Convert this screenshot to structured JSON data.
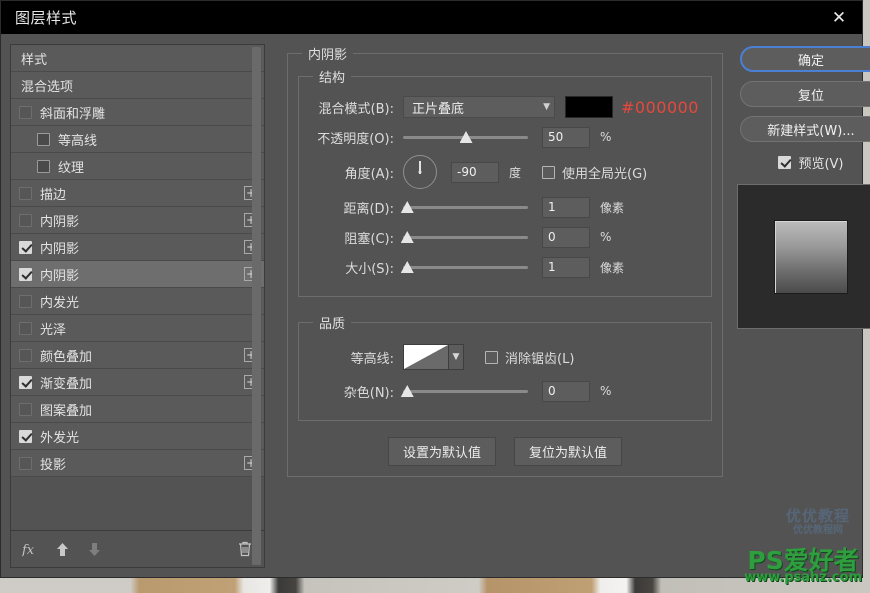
{
  "window": {
    "title": "图层样式",
    "close_icon": "close-icon"
  },
  "sidebar": {
    "items": [
      {
        "label": "样式",
        "checkbox": "none",
        "plus": false,
        "indent": false,
        "selected": false
      },
      {
        "label": "混合选项",
        "checkbox": "none",
        "plus": false,
        "indent": false,
        "selected": false
      },
      {
        "label": "斜面和浮雕",
        "checkbox": "off",
        "plus": false,
        "indent": false,
        "selected": false
      },
      {
        "label": "等高线",
        "checkbox": "off",
        "plus": false,
        "indent": true,
        "selected": false
      },
      {
        "label": "纹理",
        "checkbox": "off",
        "plus": false,
        "indent": true,
        "selected": false
      },
      {
        "label": "描边",
        "checkbox": "off",
        "plus": true,
        "indent": false,
        "selected": false
      },
      {
        "label": "内阴影",
        "checkbox": "off",
        "plus": true,
        "indent": false,
        "selected": false
      },
      {
        "label": "内阴影",
        "checkbox": "on",
        "plus": true,
        "indent": false,
        "selected": false
      },
      {
        "label": "内阴影",
        "checkbox": "on",
        "plus": true,
        "indent": false,
        "selected": true
      },
      {
        "label": "内发光",
        "checkbox": "off",
        "plus": false,
        "indent": false,
        "selected": false
      },
      {
        "label": "光泽",
        "checkbox": "off",
        "plus": false,
        "indent": false,
        "selected": false
      },
      {
        "label": "颜色叠加",
        "checkbox": "off",
        "plus": true,
        "indent": false,
        "selected": false
      },
      {
        "label": "渐变叠加",
        "checkbox": "on",
        "plus": true,
        "indent": false,
        "selected": false
      },
      {
        "label": "图案叠加",
        "checkbox": "off",
        "plus": false,
        "indent": false,
        "selected": false
      },
      {
        "label": "外发光",
        "checkbox": "on",
        "plus": false,
        "indent": false,
        "selected": false
      },
      {
        "label": "投影",
        "checkbox": "off",
        "plus": true,
        "indent": false,
        "selected": false
      }
    ],
    "toolbar": {
      "fx_label": "fx",
      "up_arrow": "↑",
      "down_arrow": "↓",
      "trash": "🗑"
    }
  },
  "main": {
    "section_title": "内阴影",
    "structure": {
      "legend": "结构",
      "blend_mode_label": "混合模式(B):",
      "blend_mode_value": "正片叠底",
      "color_swatch_hex": "#000000",
      "hex_annotation": "#000000",
      "opacity_label": "不透明度(O):",
      "opacity_value": "50",
      "opacity_unit": "%",
      "opacity_percent": 50,
      "angle_label": "角度(A):",
      "angle_value": "-90",
      "angle_unit": "度",
      "use_global_light_label": "使用全局光(G)",
      "use_global_light_checked": false,
      "distance_label": "距离(D):",
      "distance_value": "1",
      "distance_unit": "像素",
      "distance_percent": 3,
      "choke_label": "阻塞(C):",
      "choke_value": "0",
      "choke_unit": "%",
      "choke_percent": 3,
      "size_label": "大小(S):",
      "size_value": "1",
      "size_unit": "像素",
      "size_percent": 3
    },
    "quality": {
      "legend": "品质",
      "contour_label": "等高线:",
      "antialias_label": "消除锯齿(L)",
      "antialias_checked": false,
      "noise_label": "杂色(N):",
      "noise_value": "0",
      "noise_unit": "%",
      "noise_percent": 3
    },
    "defaults": {
      "make_default": "设置为默认值",
      "reset_default": "复位为默认值"
    }
  },
  "right": {
    "ok_button": "确定",
    "reset_button": "复位",
    "new_style_button": "新建样式(W)...",
    "preview_label": "预览(V)",
    "preview_checked": true
  },
  "watermarks": {
    "blue_main": "优优教程",
    "blue_sub": "优优教程网",
    "green_main": "PS爱好者",
    "green_url": "www.psahz.com"
  }
}
